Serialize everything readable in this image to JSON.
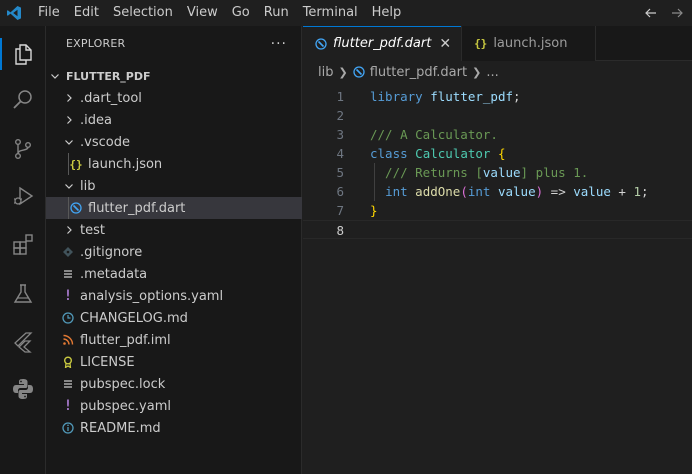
{
  "menu": [
    "File",
    "Edit",
    "Selection",
    "View",
    "Go",
    "Run",
    "Terminal",
    "Help"
  ],
  "sidebar": {
    "title": "EXPLORER",
    "more": "···",
    "root": "FLUTTER_PDF",
    "items": [
      {
        "label": ".dart_tool",
        "type": "folder",
        "expanded": false
      },
      {
        "label": ".idea",
        "type": "folder",
        "expanded": false
      },
      {
        "label": ".vscode",
        "type": "folder",
        "expanded": true
      },
      {
        "label": "launch.json",
        "type": "json"
      },
      {
        "label": "lib",
        "type": "folder",
        "expanded": true
      },
      {
        "label": "flutter_pdf.dart",
        "type": "dart",
        "selected": true
      },
      {
        "label": "test",
        "type": "folder",
        "expanded": false
      },
      {
        "label": ".gitignore",
        "type": "git"
      },
      {
        "label": ".metadata",
        "type": "lines"
      },
      {
        "label": "analysis_options.yaml",
        "type": "yaml"
      },
      {
        "label": "CHANGELOG.md",
        "type": "clock"
      },
      {
        "label": "flutter_pdf.iml",
        "type": "rss"
      },
      {
        "label": "LICENSE",
        "type": "license"
      },
      {
        "label": "pubspec.lock",
        "type": "lines"
      },
      {
        "label": "pubspec.yaml",
        "type": "yaml"
      },
      {
        "label": "README.md",
        "type": "info"
      }
    ]
  },
  "tabs": [
    {
      "label": "flutter_pdf.dart",
      "active": true,
      "icon": "dart-icon"
    },
    {
      "label": "launch.json",
      "active": false,
      "icon": "json-icon"
    }
  ],
  "breadcrumb": {
    "folder": "lib",
    "file": "flutter_pdf.dart",
    "symbol": "..."
  },
  "code": {
    "line_numbers": [
      "1",
      "2",
      "3",
      "4",
      "5",
      "6",
      "7",
      "8"
    ],
    "lines": [
      [
        {
          "t": "library",
          "c": "kw"
        },
        {
          "t": " ",
          "c": "pl"
        },
        {
          "t": "flutter_pdf",
          "c": "id"
        },
        {
          "t": ";",
          "c": "pl"
        }
      ],
      [],
      [
        {
          "t": "/// A Calculator.",
          "c": "cm"
        }
      ],
      [
        {
          "t": "class",
          "c": "kw"
        },
        {
          "t": " ",
          "c": "pl"
        },
        {
          "t": "Calculator",
          "c": "cls"
        },
        {
          "t": " ",
          "c": "pl"
        },
        {
          "t": "{",
          "c": "br1"
        }
      ],
      [
        {
          "t": "  /// Returns ",
          "c": "cm"
        },
        {
          "t": "[",
          "c": "cm"
        },
        {
          "t": "value",
          "c": "id"
        },
        {
          "t": "]",
          "c": "cm"
        },
        {
          "t": " plus 1.",
          "c": "cm"
        }
      ],
      [
        {
          "t": "  ",
          "c": "pl"
        },
        {
          "t": "int",
          "c": "kw"
        },
        {
          "t": " ",
          "c": "pl"
        },
        {
          "t": "addOne",
          "c": "fn"
        },
        {
          "t": "(",
          "c": "br2"
        },
        {
          "t": "int",
          "c": "kw"
        },
        {
          "t": " ",
          "c": "pl"
        },
        {
          "t": "value",
          "c": "id"
        },
        {
          "t": ")",
          "c": "br2"
        },
        {
          "t": " => ",
          "c": "pl"
        },
        {
          "t": "value",
          "c": "id"
        },
        {
          "t": " + ",
          "c": "pl"
        },
        {
          "t": "1",
          "c": "num"
        },
        {
          "t": ";",
          "c": "pl"
        }
      ],
      [
        {
          "t": "}",
          "c": "br1"
        }
      ],
      []
    ],
    "current_line": 8
  },
  "icons": {
    "activity": [
      "explorer-icon",
      "search-icon",
      "source-control-icon",
      "run-debug-icon",
      "extensions-icon",
      "testing-icon",
      "flutter-icon",
      "python-icon"
    ]
  },
  "colors": {
    "accent": "#0078d4",
    "dart": "#42a5f5",
    "json": "#cbcb41",
    "yaml": "#a074c4",
    "rss": "#e37933",
    "license": "#cbcb41",
    "info": "#519aba"
  }
}
